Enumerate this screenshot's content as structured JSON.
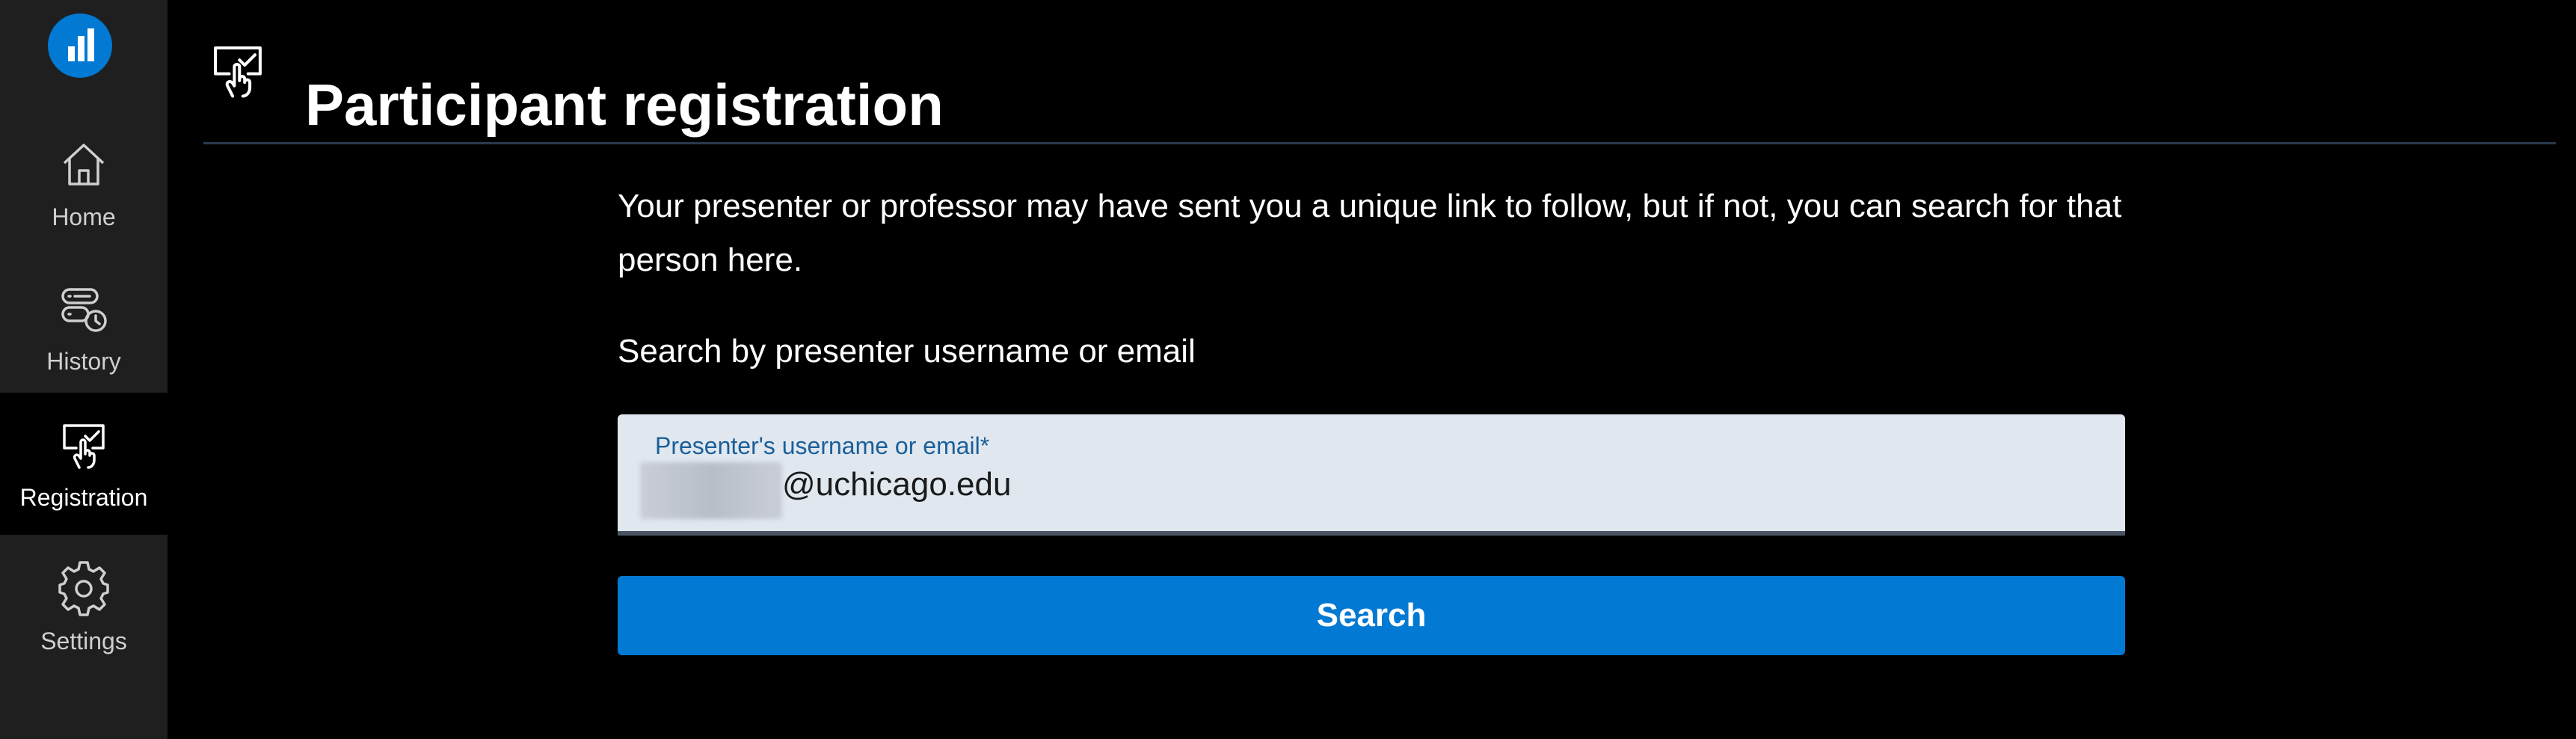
{
  "sidebar": {
    "logo_icon": "bar-chart-logo-icon",
    "items": [
      {
        "label": "Home",
        "icon": "home-icon"
      },
      {
        "label": "History",
        "icon": "history-icon"
      },
      {
        "label": "Registration",
        "icon": "registration-icon",
        "active": true
      },
      {
        "label": "Settings",
        "icon": "gear-icon"
      }
    ]
  },
  "header": {
    "title": "Participant registration",
    "icon": "registration-icon"
  },
  "main": {
    "intro": "Your presenter or professor may have sent you a unique link to follow, but if not, you can search for that person here.",
    "search_heading": "Search by presenter username or email",
    "field_label": "Presenter's username or email*",
    "field_value": "@uchicago.edu",
    "search_button": "Search"
  },
  "colors": {
    "accent": "#0279d2",
    "sidebar_bg": "#1f1f1f",
    "page_bg": "#000000",
    "field_bg": "#e0e7ef",
    "field_label": "#1a5f99"
  }
}
